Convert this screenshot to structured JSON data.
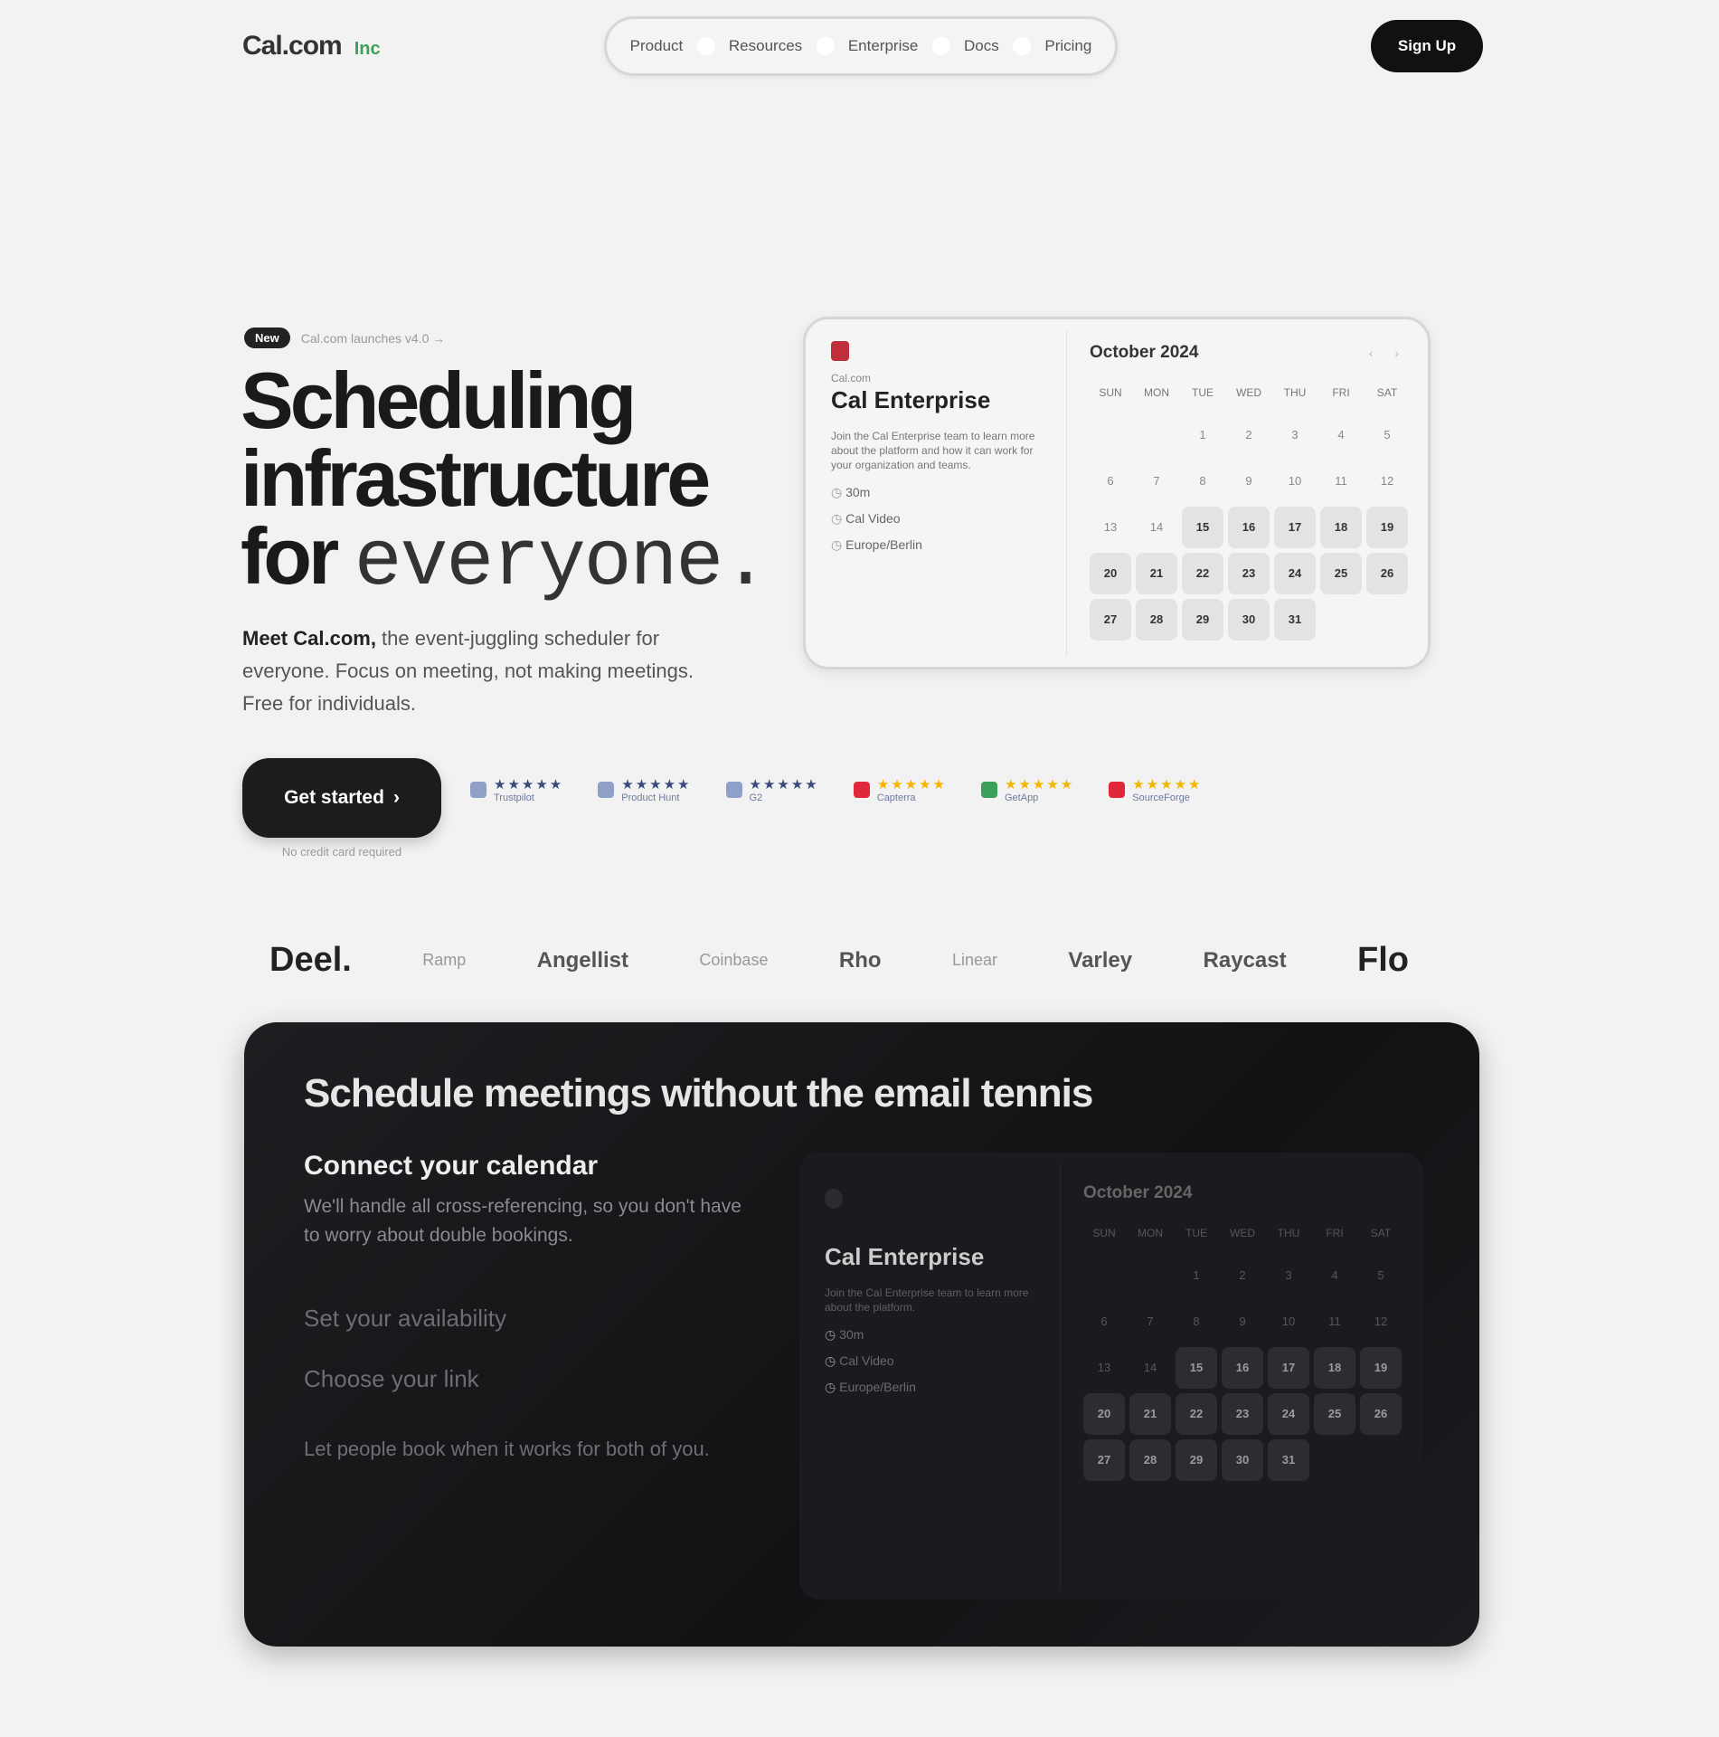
{
  "header": {
    "logo": "Cal.com",
    "logo_badge": "Inc",
    "nav": [
      "Product",
      "Resources",
      "Enterprise",
      "Docs",
      "Pricing"
    ],
    "cta": "Sign Up"
  },
  "hero": {
    "badge_pill": "New",
    "badge_text": "Cal.com launches v4.0 →",
    "title_line1": "Scheduling",
    "title_line2": "infrastructure",
    "title_for": "for",
    "title_accent": "everyone.",
    "subtitle_brand": "Meet Cal.com,",
    "subtitle_rest": " the event-juggling scheduler for everyone. Focus on meeting, not making meetings. Free for individuals.",
    "cta_label": "Get started",
    "cta_arrow": "›",
    "cta_note": "No credit card required"
  },
  "ratings": [
    {
      "stars": "★★★★★",
      "name": "Trustpilot",
      "color": "#3a4a7a",
      "logo_color": "#8fa0c8"
    },
    {
      "stars": "★★★★★",
      "name": "Product Hunt",
      "color": "#3a4a7a",
      "logo_color": "#8fa0c8"
    },
    {
      "stars": "★★★★★",
      "name": "G2",
      "color": "#3a4a7a",
      "logo_color": "#8fa0c8"
    },
    {
      "stars": "★★★★★",
      "name": "Capterra",
      "color": "#f5b400",
      "logo_color": "#e0283a"
    },
    {
      "stars": "★★★★★",
      "name": "GetApp",
      "color": "#f5b400",
      "logo_color": "#3aa05a"
    },
    {
      "stars": "★★★★★",
      "name": "SourceForge",
      "color": "#f5b400",
      "logo_color": "#e0283a"
    }
  ],
  "booking": {
    "host": "Cal.com",
    "title": "Cal Enterprise",
    "description": "Join the Cal Enterprise team to learn more about the platform and how it can work for your organization and teams.",
    "meta": [
      "30m",
      "Cal Video",
      "Europe/Berlin"
    ],
    "month": "October 2024",
    "nav": "‹ ›",
    "dow": [
      "SUN",
      "MON",
      "TUE",
      "WED",
      "THU",
      "FRI",
      "SAT"
    ],
    "days": [
      "",
      "",
      "1",
      "2",
      "3",
      "4",
      "5",
      "6",
      "7",
      "8",
      "9",
      "10",
      "11",
      "12",
      "13",
      "14",
      "15",
      "16",
      "17",
      "18",
      "19",
      "20",
      "21",
      "22",
      "23",
      "24",
      "25",
      "26",
      "27",
      "28",
      "29",
      "30",
      "31",
      "",
      ""
    ],
    "available_from": "15"
  },
  "logos": [
    "Deel.",
    "Ramp",
    "Angellist",
    "Coinbase",
    "Rho",
    "Linear",
    "Varley",
    "Raycast",
    "Flo"
  ],
  "feature": {
    "title": "Schedule meetings without the email tennis",
    "step1_title": "Connect your calendar",
    "step1_desc": "We'll handle all cross-referencing, so you don't have to worry about double bookings.",
    "step2_title": "Set your availability",
    "step3_title": "Choose your link",
    "foot": "Let people book when it works for both of you."
  },
  "dark_booking": {
    "title": "Cal Enterprise",
    "description": "Join the Cal Enterprise team to learn more about the platform.",
    "meta": [
      "30m",
      "Cal Video",
      "Europe/Berlin"
    ],
    "month": "October 2024"
  }
}
